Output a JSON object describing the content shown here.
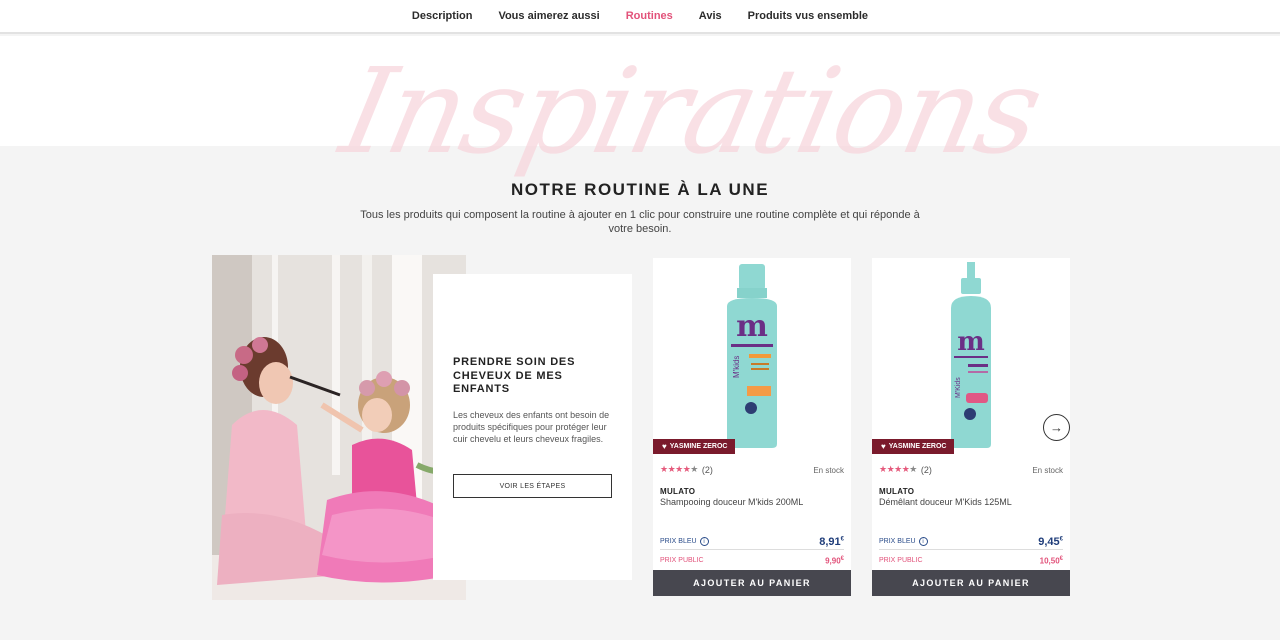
{
  "nav": {
    "items": [
      {
        "label": "Description",
        "active": false
      },
      {
        "label": "Vous aimerez aussi",
        "active": false
      },
      {
        "label": "Routines",
        "active": true
      },
      {
        "label": "Avis",
        "active": false
      },
      {
        "label": "Produits vus ensemble",
        "active": false
      }
    ]
  },
  "hero": {
    "script_text": "Inspirations",
    "title": "NOTRE ROUTINE À LA UNE",
    "subtitle": "Tous les produits qui composent la routine à ajouter en 1 clic pour construire une routine complète et qui réponde à votre besoin."
  },
  "routine": {
    "title": "PRENDRE SOIN DES CHEVEUX DE MES ENFANTS",
    "description": "Les cheveux des enfants ont besoin de produits spécifiques pour protéger leur cuir chevelu et leurs cheveux fragiles.",
    "button": "VOIR LES ÉTAPES"
  },
  "products": [
    {
      "badge": "YASMINE ZEROC",
      "review_count": "(2)",
      "stock": "En stock",
      "brand": "MULATO",
      "name": "Shampooing douceur M'kids 200ML",
      "prix_bleu_label": "PRIX BLEU",
      "prix_bleu_main": "8,91",
      "prix_public_label": "PRIX PUBLIC",
      "prix_public_main": "9,90",
      "currency": "€",
      "cart": "AJOUTER AU PANIER",
      "rating": 4
    },
    {
      "badge": "YASMINE ZEROC",
      "review_count": "(2)",
      "stock": "En stock",
      "brand": "MULATO",
      "name": "Démêlant douceur M'Kids 125ML",
      "prix_bleu_label": "PRIX BLEU",
      "prix_bleu_main": "9,45",
      "prix_public_label": "PRIX PUBLIC",
      "prix_public_main": "10,50",
      "currency": "€",
      "cart": "AJOUTER AU PANIER",
      "rating": 4
    }
  ],
  "colors": {
    "accent": "#e2527a",
    "badge": "#7a1a2c",
    "cart_button": "#47474f",
    "prix_bleu": "#1f3d7a",
    "bottle": "#8fd8d2"
  },
  "icons": {
    "next": "arrow-right-icon",
    "heart": "heart-icon",
    "info": "info-icon",
    "star": "star-icon"
  }
}
